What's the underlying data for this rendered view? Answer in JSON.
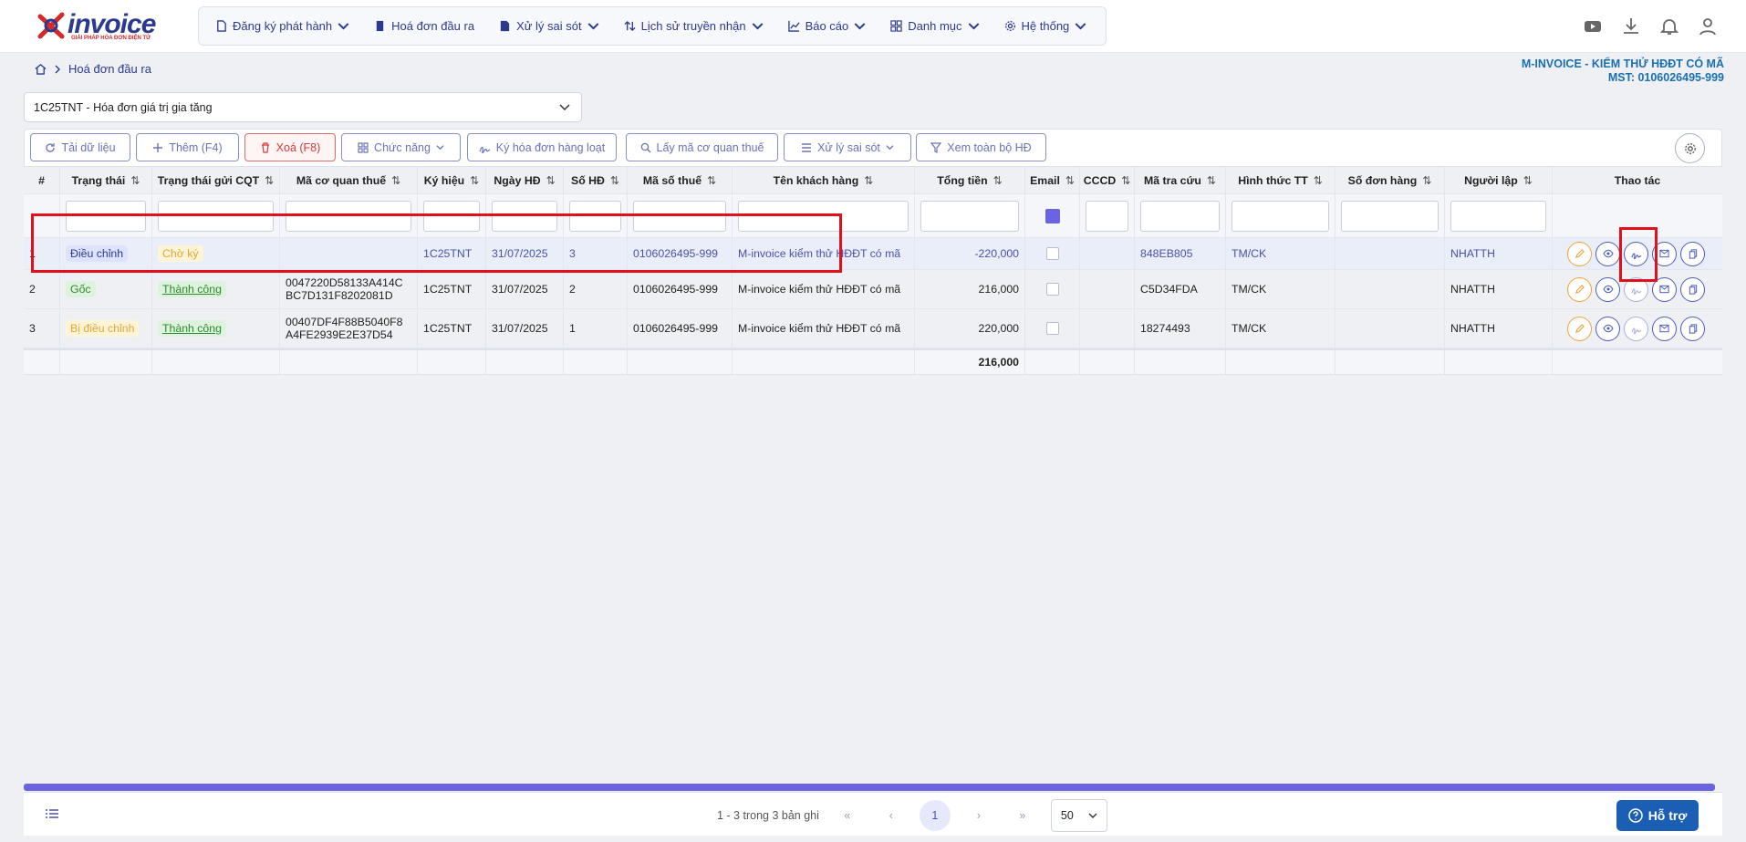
{
  "logo": {
    "text": "invoice",
    "tagline": "GIẢI PHÁP HÓA ĐƠN ĐIỆN TỬ"
  },
  "menu": [
    {
      "label": "Đăng ký phát hành",
      "icon": "file-icon",
      "dropdown": true
    },
    {
      "label": "Hoá đơn đầu ra",
      "icon": "document-icon",
      "dropdown": false
    },
    {
      "label": "Xử lý sai sót",
      "icon": "file-edit-icon",
      "dropdown": true
    },
    {
      "label": "Lịch sử truyền nhận",
      "icon": "swap-icon",
      "dropdown": true
    },
    {
      "label": "Báo cáo",
      "icon": "chart-icon",
      "dropdown": true
    },
    {
      "label": "Danh mục",
      "icon": "grid-icon",
      "dropdown": true
    },
    {
      "label": "Hệ thống",
      "icon": "gear-icon",
      "dropdown": true
    }
  ],
  "breadcrumb": {
    "current": "Hoá đơn đầu ra"
  },
  "company": {
    "name": "M-INVOICE - KIỂM THỬ HĐĐT CÓ MÃ",
    "mst": "MST: 0106026495-999"
  },
  "series_select": {
    "value": "1C25TNT - Hóa đơn giá trị gia tăng"
  },
  "toolbar": {
    "reload": "Tải dữ liệu",
    "add": "Thêm (F4)",
    "delete": "Xoá (F8)",
    "functions": "Chức năng",
    "batch_sign": "Ký hóa đơn hàng loạt",
    "get_code": "Lấy mã cơ quan thuế",
    "handle_errors": "Xử lý sai sót",
    "view_all": "Xem toàn bộ HĐ"
  },
  "columns": [
    "#",
    "Trạng thái",
    "Trạng thái gửi CQT",
    "Mã cơ quan thuế",
    "Ký hiệu",
    "Ngày HĐ",
    "Số HĐ",
    "Mã số thuế",
    "Tên khách hàng",
    "Tổng tiền",
    "Email",
    "CCCD",
    "Mã tra cứu",
    "Hình thức TT",
    "Số đơn hàng",
    "Người lập",
    "Thao tác"
  ],
  "rows": [
    {
      "idx": "1",
      "status": "Điều chỉnh",
      "send_status": "Chờ ký",
      "tax_code_line1": "",
      "tax_code_line2": "",
      "symbol": "1C25TNT",
      "date": "31/07/2025",
      "number": "3",
      "mst": "0106026495-999",
      "customer": "M-invoice kiểm thử HĐĐT có mã",
      "total": "-220,000",
      "lookup": "848EB805",
      "payment": "TM/CK",
      "order": "",
      "creator": "NHATTH"
    },
    {
      "idx": "2",
      "status": "Gốc",
      "send_status": "Thành công",
      "tax_code_line1": "0047220D58133A414C",
      "tax_code_line2": "BC7D131F8202081D",
      "symbol": "1C25TNT",
      "date": "31/07/2025",
      "number": "2",
      "mst": "0106026495-999",
      "customer": "M-invoice kiểm thử HĐĐT có mã",
      "total": "216,000",
      "lookup": "C5D34FDA",
      "payment": "TM/CK",
      "order": "",
      "creator": "NHATTH"
    },
    {
      "idx": "3",
      "status": "Bị điều chỉnh",
      "send_status": "Thành công",
      "tax_code_line1": "00407DF4F88B5040F8",
      "tax_code_line2": "A4FE2939E2E37D54",
      "symbol": "1C25TNT",
      "date": "31/07/2025",
      "number": "1",
      "mst": "0106026495-999",
      "customer": "M-invoice kiểm thử HĐĐT có mã",
      "total": "220,000",
      "lookup": "18274493",
      "payment": "TM/CK",
      "order": "",
      "creator": "NHATTH"
    }
  ],
  "summary": {
    "total": "216,000"
  },
  "pager": {
    "info": "1 - 3 trong 3 bản ghi",
    "current": "1",
    "page_size": "50"
  },
  "help": {
    "label": "Hỗ trợ"
  },
  "colors": {
    "brand": "#2b3a8f",
    "accent": "#6b63e0",
    "danger": "#e0101c"
  }
}
